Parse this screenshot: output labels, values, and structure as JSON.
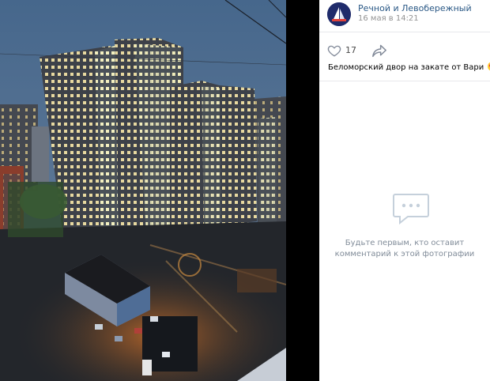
{
  "post": {
    "author": "Речной и Левобережный",
    "date": "16 мая в 14:21",
    "likes": "17",
    "caption": "Беломорский двор на закате от Вари"
  },
  "comments": {
    "empty_line1": "Будьте первым, кто оставит",
    "empty_line2": "комментарий к этой фотографии"
  },
  "colors": {
    "link": "#2a5885",
    "muted": "#939393",
    "placeholder": "#818c99"
  },
  "icons": {
    "like": "heart-icon",
    "share": "share-arrow-icon",
    "comments_empty": "speech-bubble-icon"
  }
}
